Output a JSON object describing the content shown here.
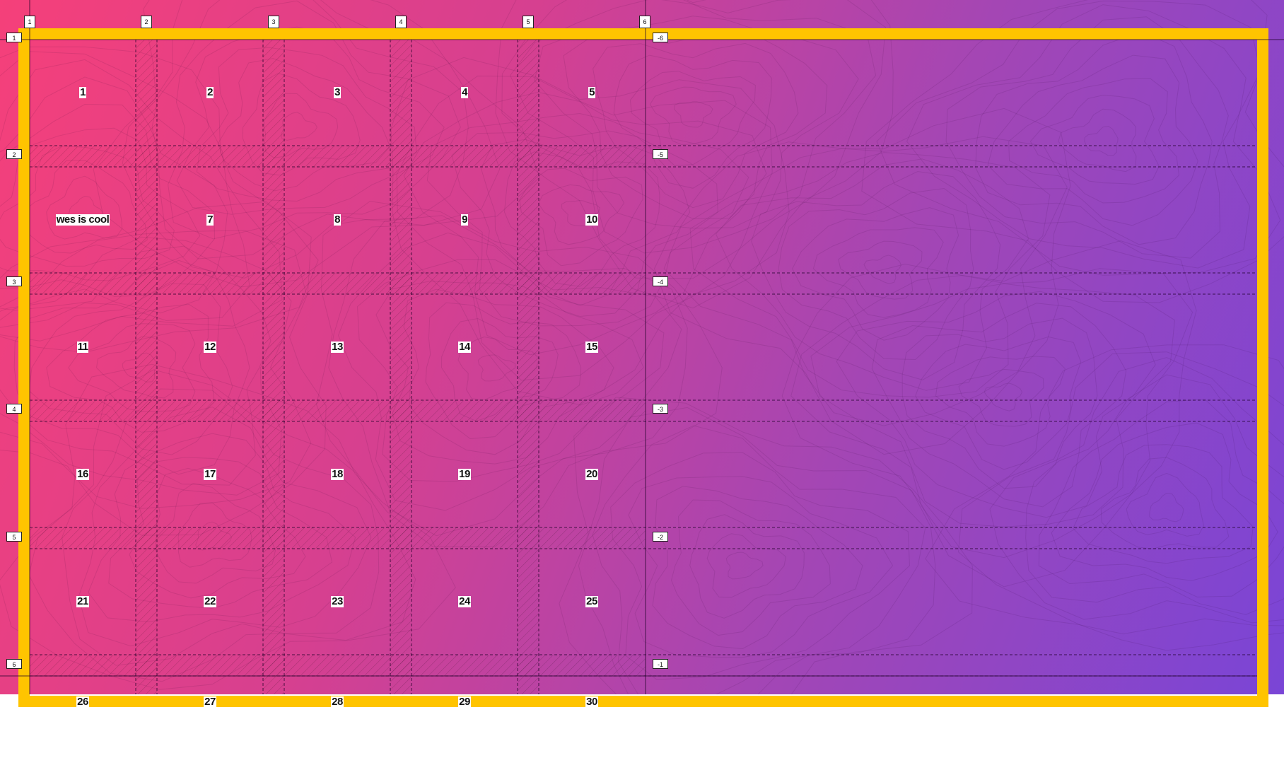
{
  "grid_cells": [
    "1",
    "2",
    "3",
    "4",
    "5",
    "wes is cool",
    "7",
    "8",
    "9",
    "10",
    "11",
    "12",
    "13",
    "14",
    "15",
    "16",
    "17",
    "18",
    "19",
    "20",
    "21",
    "22",
    "23",
    "24",
    "25",
    "26",
    "27",
    "28",
    "29",
    "30"
  ],
  "column_line_labels": [
    "1",
    "2",
    "3",
    "4",
    "5",
    "6"
  ],
  "row_line_labels": [
    "1",
    "2",
    "3",
    "4",
    "5",
    "6"
  ],
  "negative_row_line_labels": [
    "-6",
    "-5",
    "-4",
    "-3",
    "-2",
    "-1"
  ],
  "colors": {
    "gradient_start": "#f5407a",
    "gradient_end": "#7a45d6",
    "container_border": "#ffc400",
    "cell_label_bg": "#ffffff"
  }
}
